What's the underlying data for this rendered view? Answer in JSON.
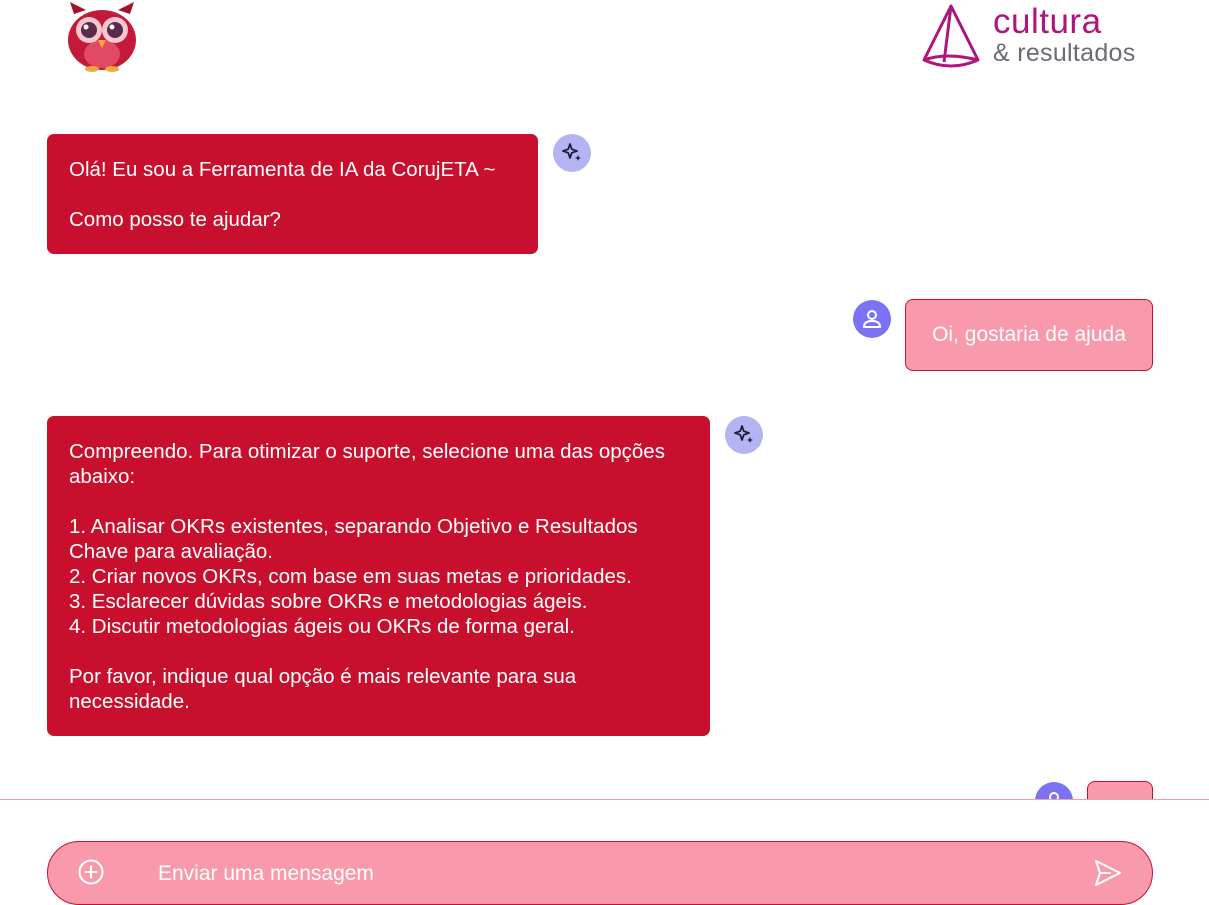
{
  "header": {
    "logo_owl": "owl-mascot",
    "brand_line1": "cultura",
    "brand_line2": "& resultados"
  },
  "colors": {
    "bot_bubble": "#c8102e",
    "user_bubble": "#f89aab",
    "bot_avatar": "#b4b4f2",
    "user_avatar": "#7b73f4",
    "brand": "#b0157f"
  },
  "messages": [
    {
      "role": "assistant",
      "text": "Olá! Eu sou a Ferramenta de IA da CorujETA ~\n\nComo posso te ajudar?",
      "icon": "sparkles-icon"
    },
    {
      "role": "user",
      "text": "Oi, gostaria de ajuda",
      "icon": "user-icon"
    },
    {
      "role": "assistant",
      "text": "Compreendo. Para otimizar o suporte, selecione uma das opções abaixo:\n\n1. Analisar OKRs existentes, separando Objetivo e Resultados Chave para avaliação.\n2. Criar novos OKRs, com base em suas metas e prioridades.\n3. Esclarecer dúvidas sobre OKRs e metodologias ágeis.\n4. Discutir metodologias ágeis ou OKRs de forma geral.\n\nPor favor, indique qual opção é mais relevante para sua necessidade.",
      "icon": "sparkles-icon"
    },
    {
      "role": "user",
      "text": "",
      "icon": "user-icon"
    }
  ],
  "composer": {
    "placeholder": "Enviar uma mensagem",
    "value": "",
    "add_icon": "plus-circle-icon",
    "send_icon": "send-icon"
  }
}
